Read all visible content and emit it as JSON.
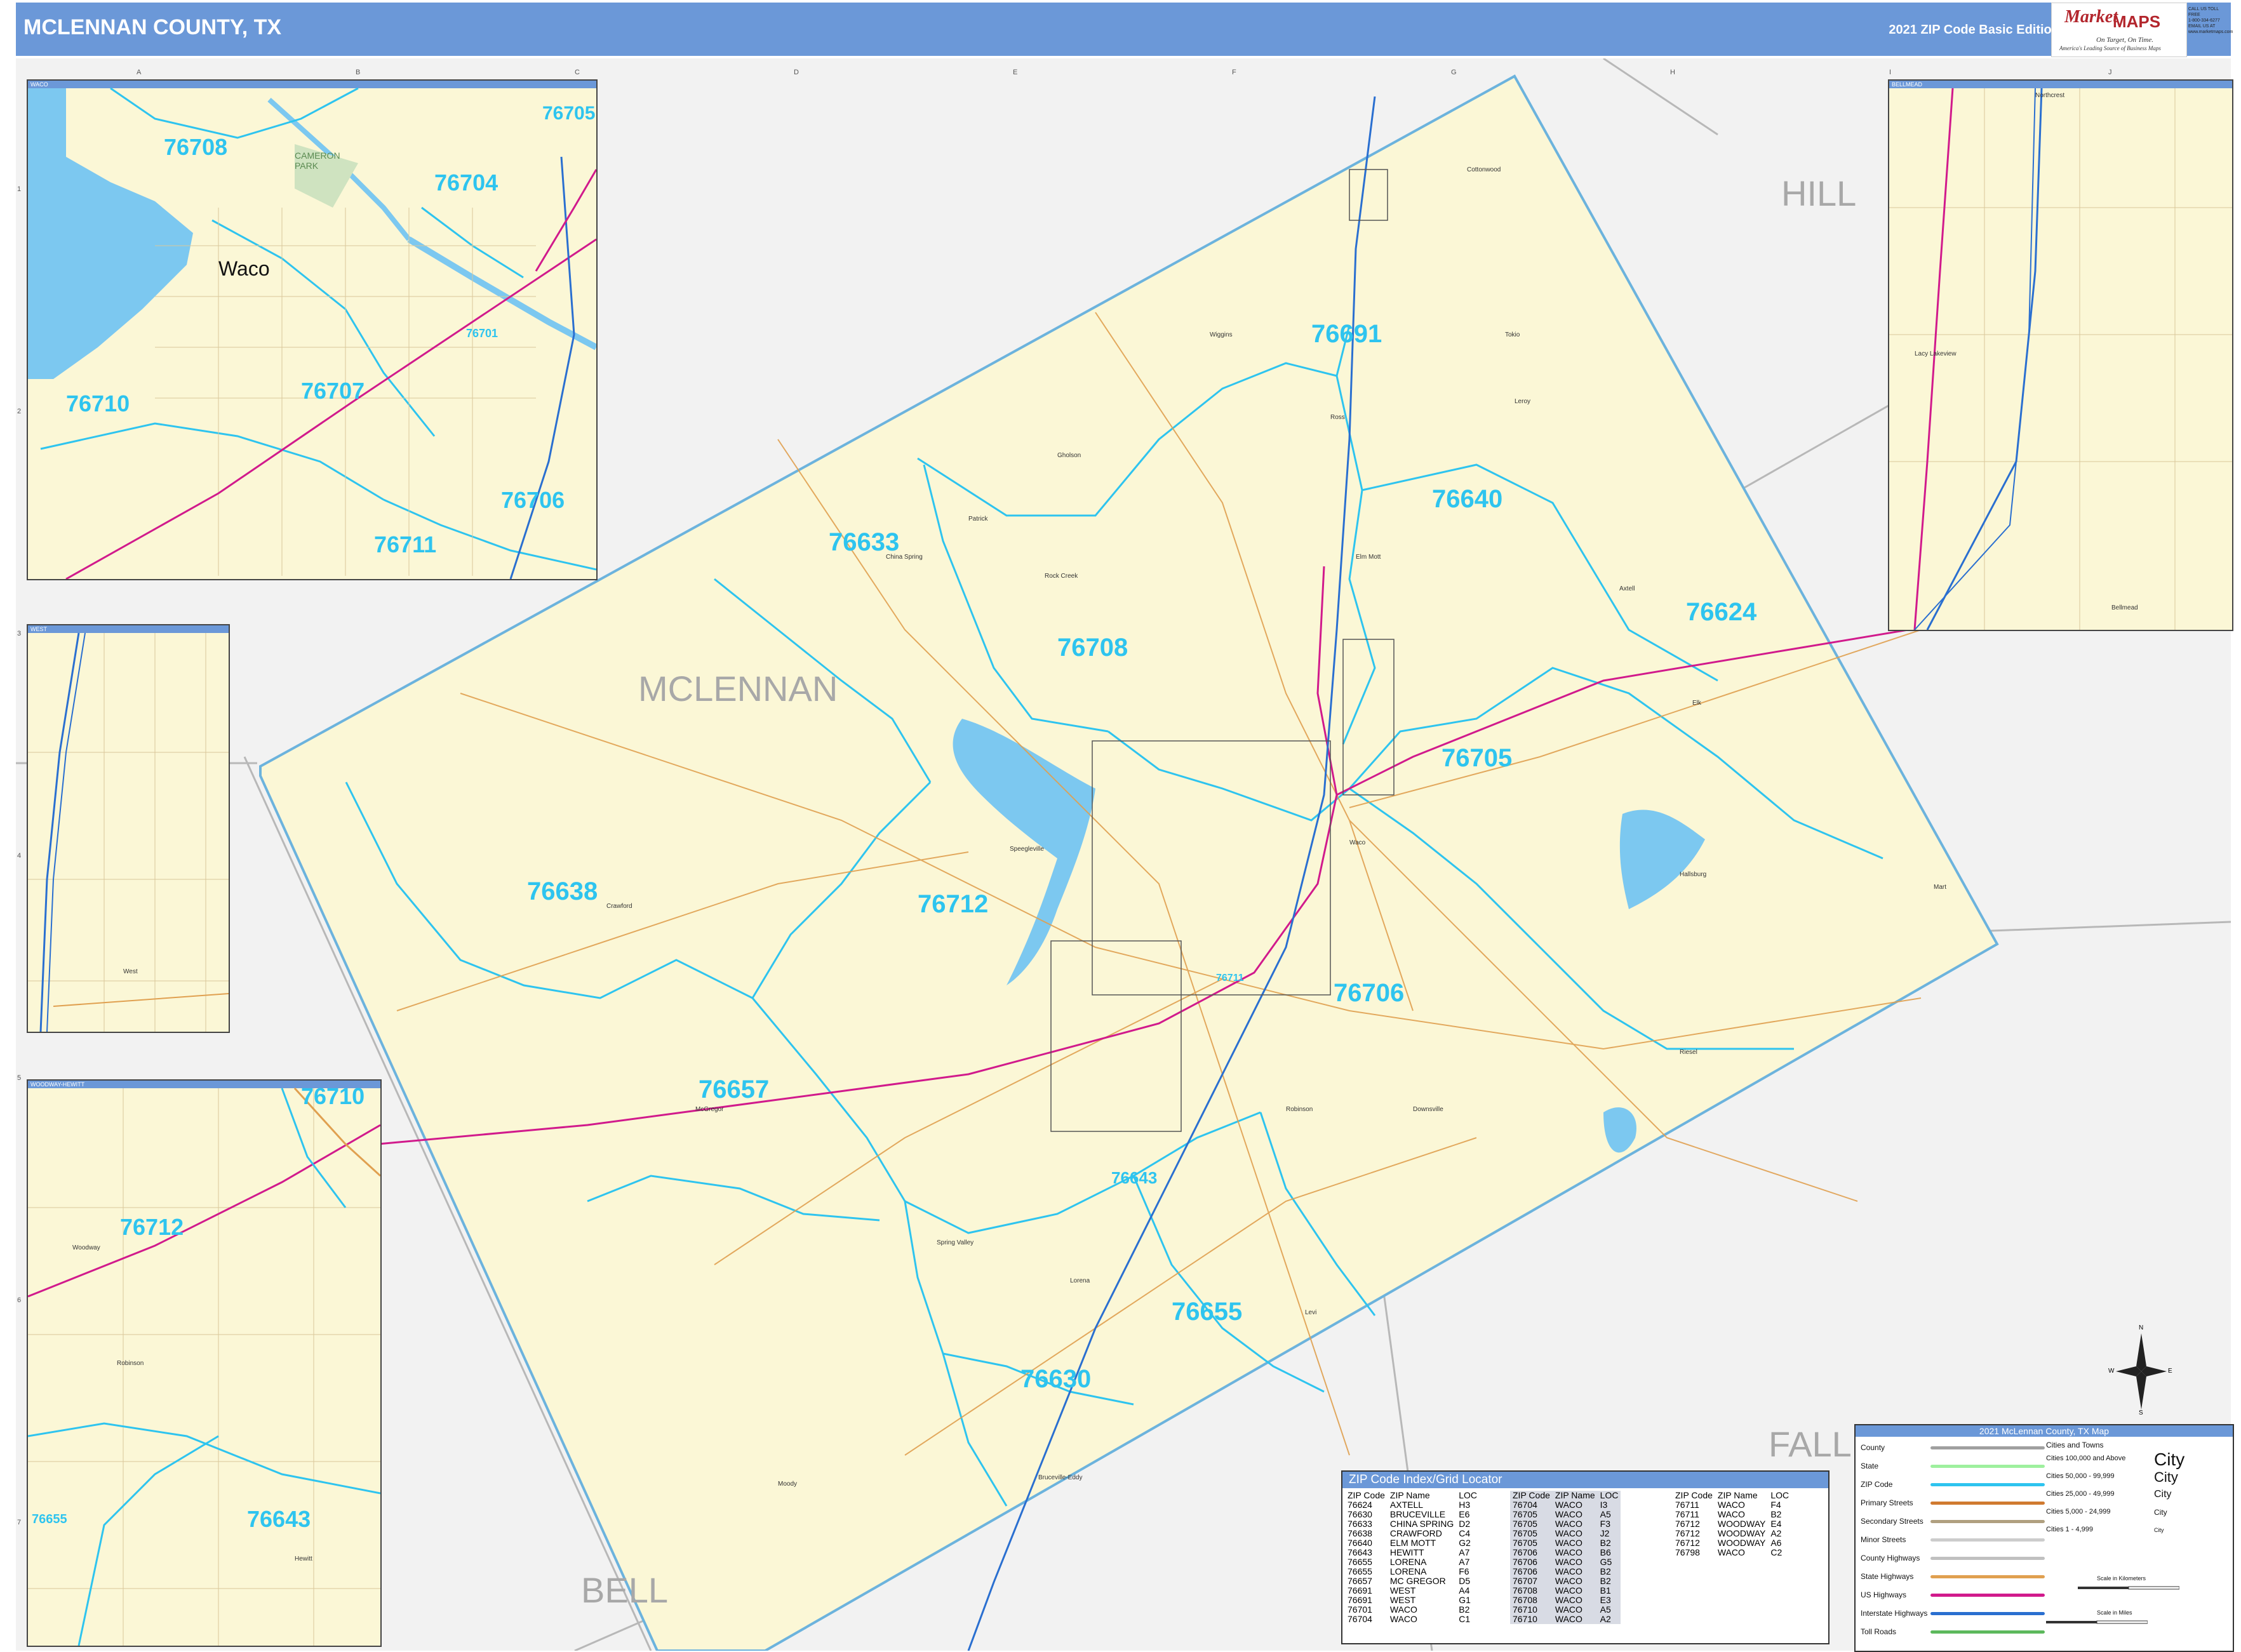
{
  "header": {
    "title": "MCLENNAN COUNTY, TX",
    "edition": "2021 ZIP Code Basic Edition"
  },
  "logo": {
    "brand_a": "Market",
    "brand_b": "MAPS",
    "tagline": "On Target, On Time.",
    "sub": "America's Leading Source of Business Maps",
    "contact": [
      "CALL US TOLL FREE",
      "1-800-334-6277",
      "EMAIL US AT",
      "www.marketmaps.com"
    ]
  },
  "grid": {
    "columns": [
      "A",
      "B",
      "C",
      "D",
      "E",
      "F",
      "G",
      "H",
      "I",
      "J"
    ],
    "rows": [
      "1",
      "2",
      "3",
      "4",
      "5",
      "6",
      "7"
    ]
  },
  "counties": {
    "main": "MCLENNAN",
    "hill": "HILL",
    "bell": "BELL",
    "falls": "FALL"
  },
  "zip_labels": {
    "z76691": "76691",
    "z76640": "76640",
    "z76633": "76633",
    "z76624": "76624",
    "z76708": "76708",
    "z76705": "76705",
    "z76638": "76638",
    "z76712": "76712",
    "z76706": "76706",
    "z76657": "76657",
    "z76643": "76643",
    "z76655": "76655",
    "z76630": "76630",
    "z76711": "76711"
  },
  "insets": {
    "waco": {
      "title": "WACO",
      "city": "Waco",
      "park": "CAMERON PARK",
      "zips": {
        "a": "76708",
        "b": "76704",
        "c": "76705",
        "d": "76710",
        "e": "76707",
        "f": "76706",
        "g": "76711",
        "h": "76701"
      }
    },
    "bellmead": {
      "title": "BELLMEAD",
      "towns": [
        "Northcrest",
        "Lacy Lakeview",
        "Bellmead"
      ]
    },
    "west": {
      "title": "WEST",
      "town": "West"
    },
    "woodway": {
      "title": "WOODWAY-HEWITT",
      "zips": {
        "a": "76710",
        "b": "76712",
        "c": "76655",
        "d": "76643"
      },
      "towns": [
        "Woodway",
        "Hewitt",
        "Robinson"
      ]
    }
  },
  "towns": {
    "cottonwood": "Cottonwood",
    "wiggins": "Wiggins",
    "tokio": "Tokio",
    "ross": "Ross",
    "elm_mott": "Elm Mott",
    "leroy": "Leroy",
    "axtell": "Axtell",
    "gholson": "Gholson",
    "patrick": "Patrick",
    "china_spring": "China Spring",
    "rock_creek": "Rock Creek",
    "elk": "Elk",
    "speegleville": "Speegleville",
    "waco": "Waco",
    "crawford": "Crawford",
    "mcgregor": "McGregor",
    "downsville": "Downsville",
    "lorena": "Lorena",
    "bruceville": "Bruceville-Eddy",
    "mart": "Mart",
    "hallsburg": "Hallsburg",
    "riesel": "Riesel",
    "moody": "Moody",
    "spring_valley": "Spring Valley",
    "robinson": "Robinson",
    "levi": "Levi"
  },
  "zip_index": {
    "title": "ZIP Code Index/Grid Locator",
    "headers": [
      "ZIP Code",
      "ZIP Name",
      "LOC"
    ],
    "col1": [
      [
        "76624",
        "AXTELL",
        "H3"
      ],
      [
        "76630",
        "BRUCEVILLE",
        "E6"
      ],
      [
        "76633",
        "CHINA SPRING",
        "D2"
      ],
      [
        "76638",
        "CRAWFORD",
        "C4"
      ],
      [
        "76640",
        "ELM MOTT",
        "G2"
      ],
      [
        "76643",
        "HEWITT",
        "A7"
      ],
      [
        "76655",
        "LORENA",
        "A7"
      ],
      [
        "76655",
        "LORENA",
        "F6"
      ],
      [
        "76657",
        "MC GREGOR",
        "D5"
      ],
      [
        "76691",
        "WEST",
        "A4"
      ],
      [
        "76691",
        "WEST",
        "G1"
      ],
      [
        "76701",
        "WACO",
        "B2"
      ],
      [
        "76704",
        "WACO",
        "C1"
      ]
    ],
    "col2": [
      [
        "76704",
        "WACO",
        "I3"
      ],
      [
        "76705",
        "WACO",
        "A5"
      ],
      [
        "76705",
        "WACO",
        "F3"
      ],
      [
        "76705",
        "WACO",
        "J2"
      ],
      [
        "76705",
        "WACO",
        "B2"
      ],
      [
        "76706",
        "WACO",
        "B6"
      ],
      [
        "76706",
        "WACO",
        "G5"
      ],
      [
        "76706",
        "WACO",
        "B2"
      ],
      [
        "76707",
        "WACO",
        "B2"
      ],
      [
        "76708",
        "WACO",
        "B1"
      ],
      [
        "76708",
        "WACO",
        "E3"
      ],
      [
        "76710",
        "WACO",
        "A5"
      ],
      [
        "76710",
        "WACO",
        "A2"
      ]
    ],
    "col3": [
      [
        "76711",
        "WACO",
        "F4"
      ],
      [
        "76711",
        "WACO",
        "B2"
      ],
      [
        "76712",
        "WOODWAY",
        "E4"
      ],
      [
        "76712",
        "WOODWAY",
        "A2"
      ],
      [
        "76712",
        "WOODWAY",
        "A6"
      ],
      [
        "76798",
        "WACO",
        "C2"
      ]
    ]
  },
  "legend": {
    "title": "2021 McLennan County, TX Map",
    "rows": [
      "County",
      "State",
      "ZIP Code",
      "Primary Streets",
      "Secondary Streets",
      "Minor Streets",
      "County Highways",
      "State Highways",
      "US Highways",
      "Interstate Highways",
      "Toll Roads"
    ],
    "cities_title": "Cities and Towns",
    "city_rows": [
      "Cities 100,000 and Above",
      "Cities 50,000 - 99,999",
      "Cities 25,000 - 49,999",
      "Cities 5,000 - 24,999",
      "Cities 1 - 4,999"
    ],
    "city_samples": [
      "City",
      "City",
      "City",
      "City",
      "City"
    ],
    "scale_km": "Scale in Kilometers",
    "scale_mi": "Scale in Miles",
    "colors": {
      "county": "#a0a0a0",
      "state": "#9ef09e",
      "zip": "#2ec4ef",
      "primary": "#d07a30",
      "secondary": "#b0a080",
      "minor": "#cccccc",
      "county_hwy": "#c0c0c0",
      "state_hwy": "#e0a050",
      "us_hwy": "#d11a8c",
      "interstate": "#2a6fd0",
      "toll": "#5cb85c"
    }
  },
  "compass": {
    "n": "N",
    "s": "S",
    "e": "E",
    "w": "W"
  },
  "colors": {
    "header_bg": "#6b98d8",
    "county_fill": "#fbf7d6",
    "outside_fill": "#f2f2f2",
    "zip_line": "#2ec4ef",
    "water": "#7cc8f0"
  }
}
